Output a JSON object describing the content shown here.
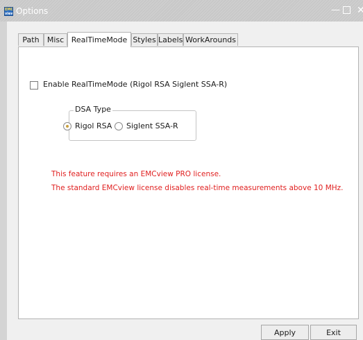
{
  "window": {
    "title": "Options",
    "icon_text_top": "EMC",
    "icon_text_bottom": "view",
    "minimize_glyph": "—",
    "close_glyph": "✕"
  },
  "tabs": [
    {
      "label": "Path",
      "active": false
    },
    {
      "label": "Misc",
      "active": false
    },
    {
      "label": "RealTimeMode",
      "active": true
    },
    {
      "label": "Styles",
      "active": false
    },
    {
      "label": "Labels",
      "active": false
    },
    {
      "label": "WorkArounds",
      "active": false
    }
  ],
  "realtime": {
    "enable_label": "Enable RealTimeMode (Rigol RSA  Siglent SSA-R)",
    "enable_checked": false,
    "dsa_group_title": "DSA Type",
    "options": [
      {
        "label": "Rigol RSA",
        "selected": true
      },
      {
        "label": "Siglent SSA-R",
        "selected": false
      }
    ],
    "warnings": [
      "This feature requires an EMCview PRO license.",
      "The standard EMCview license disables real-time measurements above 10 MHz."
    ]
  },
  "buttons": {
    "apply": "Apply",
    "exit": "Exit"
  },
  "colors": {
    "warning_text": "#e02020",
    "titlebar": "#c8c8c8",
    "radio_selected": "#c8a040"
  }
}
